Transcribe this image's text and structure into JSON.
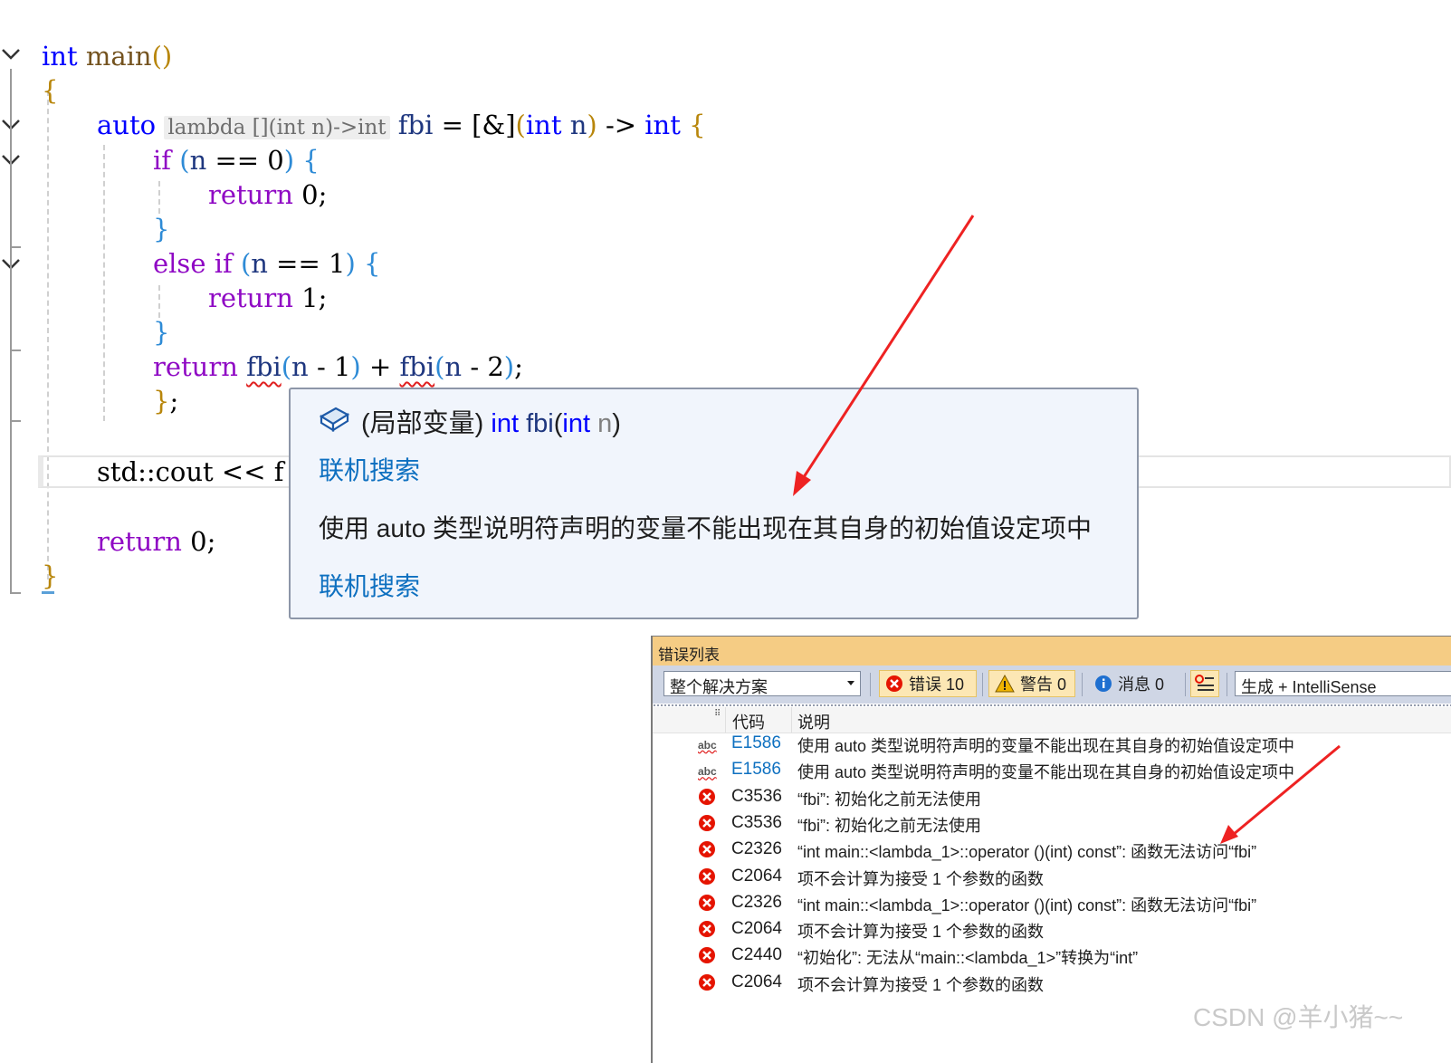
{
  "code": {
    "line1": {
      "kw": "int",
      "fn": "main",
      "open": "(",
      "close": ")"
    },
    "line2": "{",
    "line3": {
      "kw": "auto",
      "hint": "lambda [](int n)->int",
      "var": "fbi",
      "eq": "=",
      "cap": "[&]",
      "po": "(",
      "ptype": "int",
      "pname": "n",
      "pc": ")",
      "ret": "->",
      "rtype": "int",
      "brace": "{"
    },
    "line4": {
      "kw": "if",
      "po": "(",
      "var": "n",
      "op": "==",
      "num": "0",
      "pc": ")",
      "brace": "{"
    },
    "line5": {
      "kw": "return",
      "num": "0",
      "semi": ";"
    },
    "line6": "}",
    "line7": {
      "kw1": "else",
      "kw2": "if",
      "po": "(",
      "var": "n",
      "op": "==",
      "num": "1",
      "pc": ")",
      "brace": "{"
    },
    "line8": {
      "kw": "return",
      "num": "1",
      "semi": ";"
    },
    "line9": "}",
    "line10": {
      "kw": "return",
      "fn1": "fbi",
      "a1": "(",
      "v1": "n",
      "m1": "-",
      "n1": "1",
      "b1": ")",
      "plus": "+",
      "fn2": "fbi",
      "a2": "(",
      "v2": "n",
      "m2": "-",
      "n2": "2",
      "b2": ")",
      "semi": ";"
    },
    "line11": {
      "brace": "}",
      "semi": ";"
    },
    "line12": {
      "text": "std::cout",
      "op": "<<",
      "tail": "f"
    },
    "line13": {
      "kw": "return",
      "num": "0",
      "semi": ";"
    },
    "line14": "}"
  },
  "tooltip": {
    "scope": "(局部变量)",
    "type": "int",
    "name": "fbi",
    "paren_open": "(",
    "ptype": "int",
    "pname": "n",
    "paren_close": ")",
    "link1": "联机搜索",
    "message": "使用 auto 类型说明符声明的变量不能出现在其自身的初始值设定项中",
    "link2": "联机搜索"
  },
  "error_list": {
    "title": "错误列表",
    "scope": "整个解决方案",
    "errors_label": "错误 10",
    "warnings_label": "警告 0",
    "messages_label": "消息 0",
    "build_filter": "生成 + IntelliSense",
    "col_code": "代码",
    "col_desc": "说明",
    "rows": [
      {
        "icon": "abc",
        "code": "E1586",
        "desc": "使用 auto 类型说明符声明的变量不能出现在其自身的初始值设定项中"
      },
      {
        "icon": "abc",
        "code": "E1586",
        "desc": "使用 auto 类型说明符声明的变量不能出现在其自身的初始值设定项中"
      },
      {
        "icon": "error",
        "code": "C3536",
        "desc": "“fbi”: 初始化之前无法使用"
      },
      {
        "icon": "error",
        "code": "C3536",
        "desc": "“fbi”: 初始化之前无法使用"
      },
      {
        "icon": "error",
        "code": "C2326",
        "desc": "“int main::<lambda_1>::operator ()(int) const”: 函数无法访问“fbi”"
      },
      {
        "icon": "error",
        "code": "C2064",
        "desc": "项不会计算为接受 1 个参数的函数"
      },
      {
        "icon": "error",
        "code": "C2326",
        "desc": "“int main::<lambda_1>::operator ()(int) const”: 函数无法访问“fbi”"
      },
      {
        "icon": "error",
        "code": "C2064",
        "desc": "项不会计算为接受 1 个参数的函数"
      },
      {
        "icon": "error",
        "code": "C2440",
        "desc": "“初始化”: 无法从“main::<lambda_1>”转换为“int”"
      },
      {
        "icon": "error",
        "code": "C2064",
        "desc": "项不会计算为接受 1 个参数的函数"
      }
    ]
  },
  "watermark": "CSDN @羊小猪~~",
  "colors": {
    "keyword": "#0000ff",
    "control": "#8f08c4",
    "function": "#74531f",
    "variable": "#1f377f",
    "link": "#0e70c0",
    "error": "#e02020",
    "panel_title": "#f5cc84"
  }
}
